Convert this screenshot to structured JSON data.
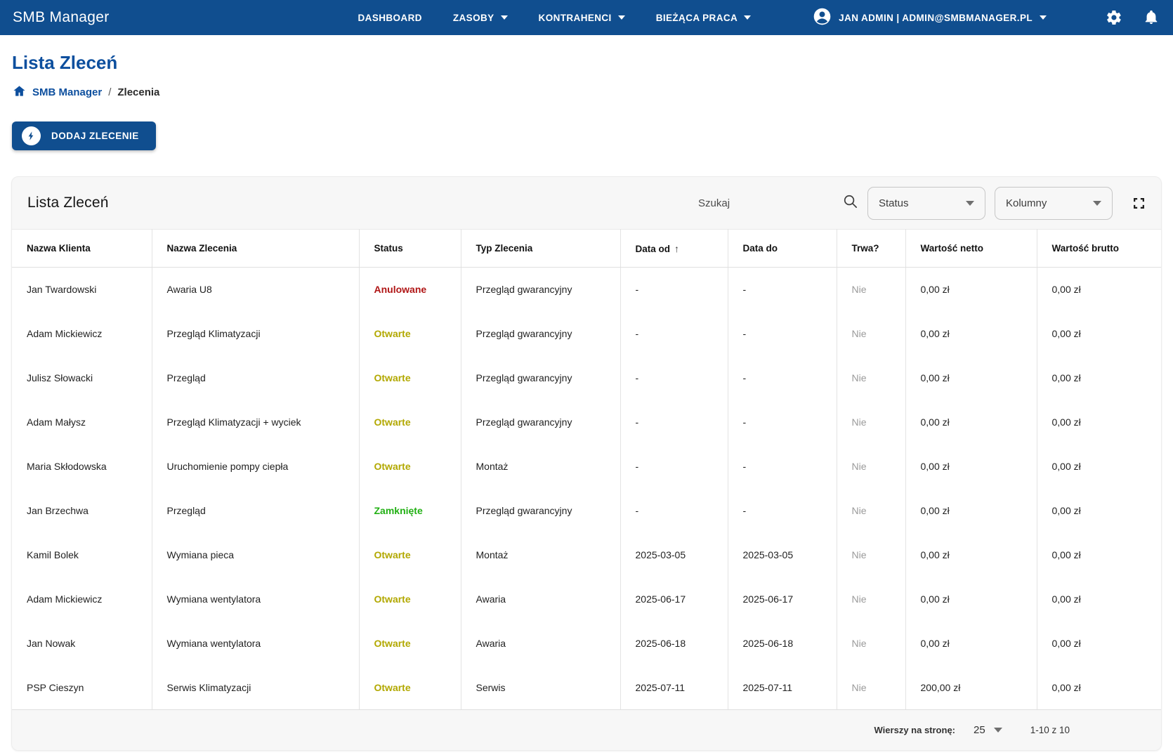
{
  "navbar": {
    "brand": "SMB Manager",
    "items": [
      {
        "label": "DASHBOARD",
        "caret": false
      },
      {
        "label": "ZASOBY",
        "caret": true
      },
      {
        "label": "KONTRAHENCI",
        "caret": true
      },
      {
        "label": "BIEŻĄCA PRACA",
        "caret": true
      }
    ],
    "user": "JAN ADMIN | ADMIN@SMBMANAGER.PL"
  },
  "page": {
    "title": "Lista Zleceń",
    "breadcrumb": {
      "home": "SMB Manager",
      "separator": "/",
      "current": "Zlecenia"
    },
    "add_button": "DODAJ ZLECENIE"
  },
  "card": {
    "title": "Lista Zleceń",
    "search_placeholder": "Szukaj",
    "status_filter": "Status",
    "columns_filter": "Kolumny"
  },
  "table": {
    "columns": [
      "Nazwa Klienta",
      "Nazwa Zlecenia",
      "Status",
      "Typ Zlecenia",
      "Data od",
      "Data do",
      "Trwa?",
      "Wartość netto",
      "Wartość brutto"
    ],
    "sort_column": "Data od",
    "sort_arrow": "↑",
    "rows": [
      {
        "client": "Jan Twardowski",
        "order": "Awaria U8",
        "status": "Anulowane",
        "status_key": "anulowane",
        "type": "Przegląd gwarancyjny",
        "date_from": "-",
        "date_to": "-",
        "ongoing": "Nie",
        "net": "0,00 zł",
        "gross": "0,00 zł"
      },
      {
        "client": "Adam Mickiewicz",
        "order": "Przegląd Klimatyzacji",
        "status": "Otwarte",
        "status_key": "otwarte",
        "type": "Przegląd gwarancyjny",
        "date_from": "-",
        "date_to": "-",
        "ongoing": "Nie",
        "net": "0,00 zł",
        "gross": "0,00 zł"
      },
      {
        "client": "Julisz Słowacki",
        "order": "Przegląd",
        "status": "Otwarte",
        "status_key": "otwarte",
        "type": "Przegląd gwarancyjny",
        "date_from": "-",
        "date_to": "-",
        "ongoing": "Nie",
        "net": "0,00 zł",
        "gross": "0,00 zł"
      },
      {
        "client": "Adam Małysz",
        "order": "Przegląd Klimatyzacji + wyciek",
        "status": "Otwarte",
        "status_key": "otwarte",
        "type": "Przegląd gwarancyjny",
        "date_from": "-",
        "date_to": "-",
        "ongoing": "Nie",
        "net": "0,00 zł",
        "gross": "0,00 zł"
      },
      {
        "client": "Maria Skłodowska",
        "order": "Uruchomienie pompy ciepła",
        "status": "Otwarte",
        "status_key": "otwarte",
        "type": "Montaż",
        "date_from": "-",
        "date_to": "-",
        "ongoing": "Nie",
        "net": "0,00 zł",
        "gross": "0,00 zł"
      },
      {
        "client": "Jan Brzechwa",
        "order": "Przegląd",
        "status": "Zamknięte",
        "status_key": "zamkniete",
        "type": "Przegląd gwarancyjny",
        "date_from": "-",
        "date_to": "-",
        "ongoing": "Nie",
        "net": "0,00 zł",
        "gross": "0,00 zł"
      },
      {
        "client": "Kamil Bolek",
        "order": "Wymiana pieca",
        "status": "Otwarte",
        "status_key": "otwarte",
        "type": "Montaż",
        "date_from": "2025-03-05",
        "date_to": "2025-03-05",
        "ongoing": "Nie",
        "net": "0,00 zł",
        "gross": "0,00 zł"
      },
      {
        "client": "Adam Mickiewicz",
        "order": "Wymiana wentylatora",
        "status": "Otwarte",
        "status_key": "otwarte",
        "type": "Awaria",
        "date_from": "2025-06-17",
        "date_to": "2025-06-17",
        "ongoing": "Nie",
        "net": "0,00 zł",
        "gross": "0,00 zł"
      },
      {
        "client": "Jan Nowak",
        "order": "Wymiana wentylatora",
        "status": "Otwarte",
        "status_key": "otwarte",
        "type": "Awaria",
        "date_from": "2025-06-18",
        "date_to": "2025-06-18",
        "ongoing": "Nie",
        "net": "0,00 zł",
        "gross": "0,00 zł"
      },
      {
        "client": "PSP Cieszyn",
        "order": "Serwis Klimatyzacji",
        "status": "Otwarte",
        "status_key": "otwarte",
        "type": "Serwis",
        "date_from": "2025-07-11",
        "date_to": "2025-07-11",
        "ongoing": "Nie",
        "net": "200,00 zł",
        "gross": "0,00 zł"
      }
    ]
  },
  "footer": {
    "rows_per_page_label": "Wierszy na stronę:",
    "rows_per_page": "25",
    "range": "1-10 z 10"
  },
  "colors": {
    "navbar": "#104e8f",
    "title_blue": "#0d4f9e",
    "status_anulowane": "#b01616",
    "status_otwarte": "#b2a800",
    "status_zamkniete": "#22b014",
    "muted_gray": "#9a9a9a"
  }
}
